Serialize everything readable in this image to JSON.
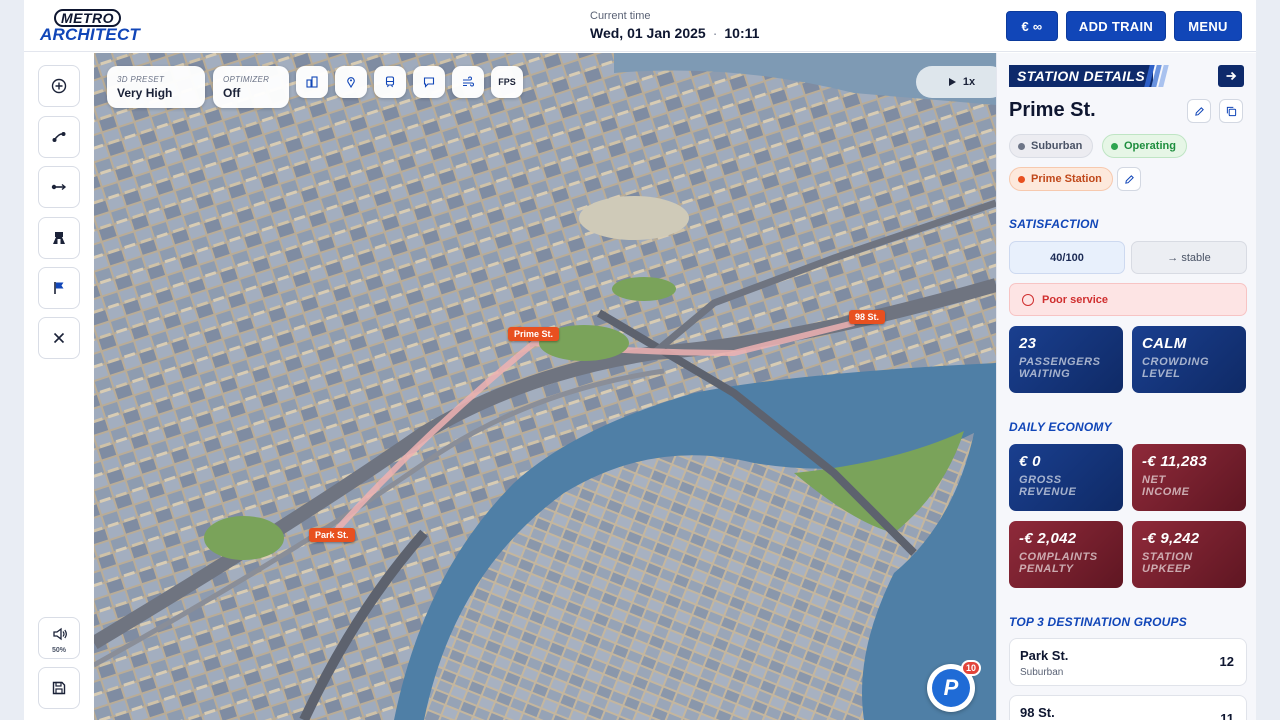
{
  "app": {
    "logo_top": "METRO",
    "logo_bottom": "ARCHITECT"
  },
  "clock": {
    "label": "Current time",
    "date": "Wed, 01 Jan 2025",
    "time": "10:11"
  },
  "header_buttons": {
    "money": "€ ∞",
    "add_train": "ADD TRAIN",
    "menu": "MENU"
  },
  "sound": {
    "volume": "50%"
  },
  "map": {
    "preset_label": "3D PRESET",
    "preset_value": "Very High",
    "optimizer_label": "OPTIMIZER",
    "optimizer_value": "Off",
    "fps_label": "FPS",
    "speed": "1x",
    "stations": [
      {
        "label": "Prime St."
      },
      {
        "label": "98 St."
      },
      {
        "label": "Park St."
      }
    ],
    "notification_count": "10",
    "notification_letter": "P"
  },
  "panel": {
    "title": "STATION DETAILS",
    "station_name": "Prime St.",
    "tags": {
      "type": "Suburban",
      "status": "Operating",
      "prime": "Prime Station"
    },
    "satisfaction": {
      "heading": "SATISFACTION",
      "value": "40/100",
      "trend": "→ stable",
      "warning": "Poor service"
    },
    "stats": {
      "passengers_value": "23",
      "passengers_caption_1": "PASSENGERS",
      "passengers_caption_2": "WAITING",
      "crowding_value": "CALM",
      "crowding_caption_1": "CROWDING",
      "crowding_caption_2": "LEVEL"
    },
    "economy": {
      "heading": "DAILY ECONOMY",
      "gross_value": "€ 0",
      "gross_caption_1": "GROSS",
      "gross_caption_2": "REVENUE",
      "net_value": "-€ 11,283",
      "net_caption_1": "NET",
      "net_caption_2": "INCOME",
      "complaints_value": "-€ 2,042",
      "complaints_caption_1": "COMPLAINTS",
      "complaints_caption_2": "PENALTY",
      "upkeep_value": "-€ 9,242",
      "upkeep_caption_1": "STATION",
      "upkeep_caption_2": "UPKEEP"
    },
    "destinations": {
      "heading": "TOP 3 DESTINATION GROUPS",
      "items": [
        {
          "name": "Park St.",
          "type": "Suburban",
          "count": "12"
        },
        {
          "name": "98 St.",
          "type": "",
          "count": "11"
        }
      ]
    }
  },
  "colors": {
    "brand_blue": "#1146b8",
    "navy": "#0e2a6b",
    "station_orange": "#e8501f",
    "water": "#4f7fa6",
    "card_red": "#7a1f2d"
  }
}
